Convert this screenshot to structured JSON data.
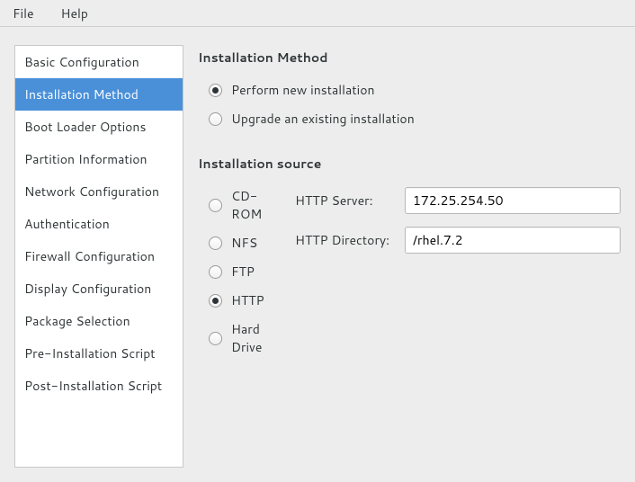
{
  "menubar": {
    "file": "File",
    "help": "Help"
  },
  "sidebar": {
    "items": [
      {
        "label": "Basic Configuration",
        "selected": false
      },
      {
        "label": "Installation Method",
        "selected": true
      },
      {
        "label": "Boot Loader Options",
        "selected": false
      },
      {
        "label": "Partition Information",
        "selected": false
      },
      {
        "label": "Network Configuration",
        "selected": false
      },
      {
        "label": "Authentication",
        "selected": false
      },
      {
        "label": "Firewall Configuration",
        "selected": false
      },
      {
        "label": "Display Configuration",
        "selected": false
      },
      {
        "label": "Package Selection",
        "selected": false
      },
      {
        "label": "Pre-Installation Script",
        "selected": false
      },
      {
        "label": "Post-Installation Script",
        "selected": false
      }
    ]
  },
  "main": {
    "method_heading": "Installation Method",
    "method_options": {
      "new": "Perform new installation",
      "upgrade": "Upgrade an existing installation"
    },
    "method_selected": "new",
    "source_heading": "Installation source",
    "source_options": {
      "cdrom": "CD-ROM",
      "nfs": "NFS",
      "ftp": "FTP",
      "http": "HTTP",
      "hd": "Hard Drive"
    },
    "source_selected": "http",
    "http_server_label": "HTTP Server:",
    "http_server_value": "172.25.254.50",
    "http_dir_label": "HTTP Directory:",
    "http_dir_value": "/rhel.7.2"
  }
}
